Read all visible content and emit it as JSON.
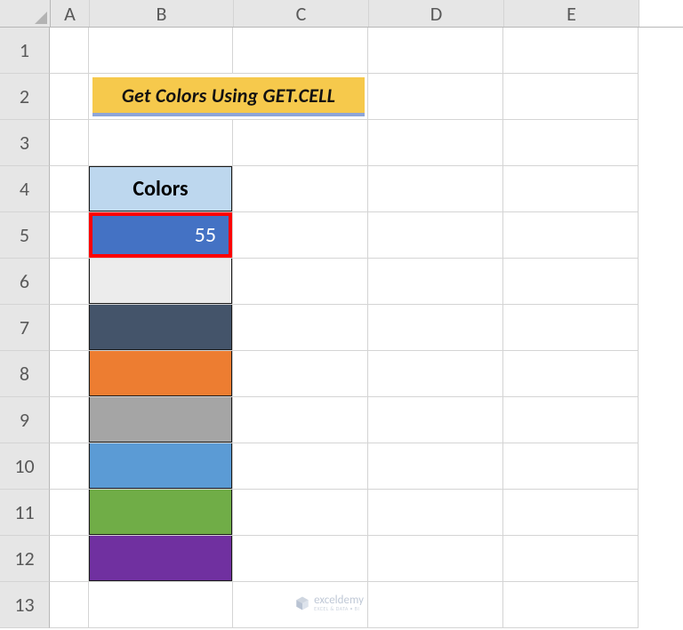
{
  "columns": [
    "A",
    "B",
    "C",
    "D",
    "E"
  ],
  "rows": [
    "1",
    "2",
    "3",
    "4",
    "5",
    "6",
    "7",
    "8",
    "9",
    "10",
    "11",
    "12",
    "13"
  ],
  "title": "Get Colors Using GET.CELL",
  "table": {
    "header": "Colors",
    "b5_value": "55",
    "swatches": [
      {
        "row": 5,
        "name": "blue",
        "hex": "#4472c4"
      },
      {
        "row": 6,
        "name": "lgray",
        "hex": "#ececec"
      },
      {
        "row": 7,
        "name": "navy",
        "hex": "#44546a"
      },
      {
        "row": 8,
        "name": "orange",
        "hex": "#ed7d31"
      },
      {
        "row": 9,
        "name": "gray",
        "hex": "#a5a5a5"
      },
      {
        "row": 10,
        "name": "skyblue",
        "hex": "#5b9bd5"
      },
      {
        "row": 11,
        "name": "green",
        "hex": "#70ad47"
      },
      {
        "row": 12,
        "name": "purple",
        "hex": "#7030a0"
      }
    ]
  },
  "watermark": {
    "brand": "exceldemy",
    "tagline": "EXCEL & DATA • BI"
  },
  "theme": {
    "accent_yellow": "#f6c94c",
    "accent_underline": "#8ea5d8",
    "table_header_bg": "#bdd7ee",
    "selection_border": "#ff0000"
  }
}
